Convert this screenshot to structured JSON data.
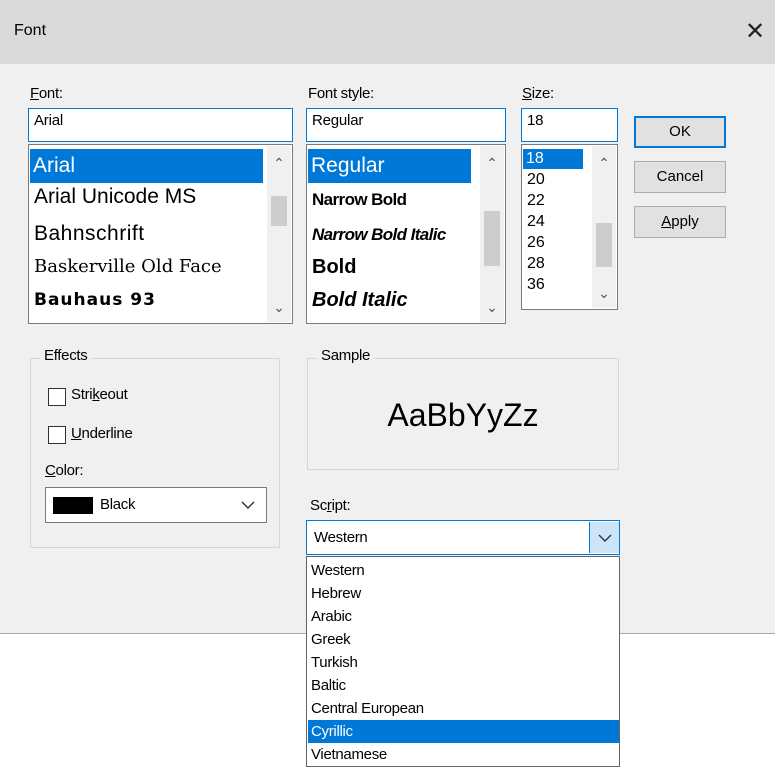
{
  "window": {
    "title": "Font",
    "close_glyph": "✕"
  },
  "font": {
    "label_underlined": "F",
    "label_rest": "ont:",
    "value": "Arial",
    "items": [
      "Arial",
      "Arial Unicode MS",
      "Bahnschrift",
      "Baskerville Old Face",
      "Bauhaus 93"
    ]
  },
  "style": {
    "label": "Font style:",
    "value": "Regular",
    "items": [
      "Regular",
      "Narrow Bold",
      "Narrow Bold Italic",
      "Bold",
      "Bold Italic"
    ]
  },
  "size": {
    "label_underlined": "S",
    "label_rest": "ize:",
    "value": "18",
    "items": [
      "18",
      "20",
      "22",
      "24",
      "26",
      "28",
      "36"
    ]
  },
  "buttons": {
    "ok": "OK",
    "cancel": "Cancel",
    "apply_underlined": "A",
    "apply_rest": "pply"
  },
  "effects": {
    "legend": "Effects",
    "strikeout_pre": "Stri",
    "strikeout_u": "k",
    "strikeout_post": "eout",
    "underline_u": "U",
    "underline_rest": "nderline",
    "color_label_u": "C",
    "color_label_rest": "olor:",
    "color_value": "Black",
    "color_swatch": "#000000"
  },
  "sample": {
    "legend": "Sample",
    "text": "AaBbYyZz"
  },
  "script": {
    "label_pre": "Sc",
    "label_u": "r",
    "label_post": "ipt:",
    "value": "Western",
    "options": [
      "Western",
      "Hebrew",
      "Arabic",
      "Greek",
      "Turkish",
      "Baltic",
      "Central European",
      "Cyrillic",
      "Vietnamese"
    ],
    "highlighted": "Cyrillic"
  },
  "colors": {
    "accent": "#0078d7",
    "dialog_bg": "#f0f0f0",
    "titlebar_bg": "#dadada"
  },
  "icons": {
    "scroll_up": "⌃",
    "scroll_down": "⌄",
    "dropdown": "chevron-down-icon"
  }
}
